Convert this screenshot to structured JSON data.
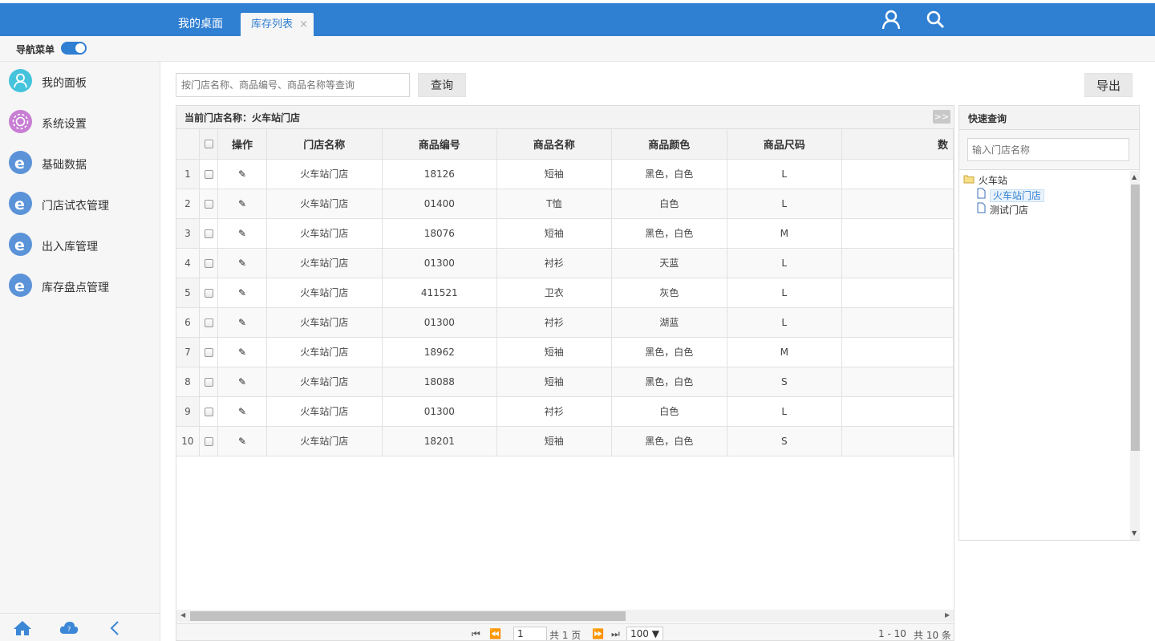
{
  "topbar": {
    "tabs": [
      {
        "label": "我的桌面"
      },
      {
        "label": "库存列表",
        "close": "×"
      }
    ],
    "icons": [
      "user-icon",
      "search-icon"
    ]
  },
  "nav": {
    "toggle_label": "导航菜单",
    "toggle_on": true
  },
  "sidebar": {
    "items": [
      {
        "label": "我的面板",
        "icon": "user-icon"
      },
      {
        "label": "系统设置",
        "icon": "gear-icon"
      },
      {
        "label": "基础数据",
        "icon": "ie-icon"
      },
      {
        "label": "门店试衣管理",
        "icon": "ie-icon"
      },
      {
        "label": "出入库管理",
        "icon": "ie-icon"
      },
      {
        "label": "库存盘点管理",
        "icon": "ie-icon"
      }
    ],
    "bottom_icons": [
      "home-icon",
      "cloud-help-icon",
      "collapse-left-icon"
    ]
  },
  "toolbar": {
    "search_placeholder": "按门店名称、商品编号、商品名称等查询",
    "query_label": "查询",
    "export_label": "导出"
  },
  "grid": {
    "caption": "当前门店名称：火车站门店",
    "expand_label": ">>",
    "columns": [
      "操作",
      "门店名称",
      "商品编号",
      "商品名称",
      "商品颜色",
      "商品尺码",
      "数"
    ],
    "rows": [
      {
        "n": "1",
        "store": "火车站门店",
        "code": "18126",
        "name": "短袖",
        "color": "黑色，白色",
        "size": "L"
      },
      {
        "n": "2",
        "store": "火车站门店",
        "code": "01400",
        "name": "T恤",
        "color": "白色",
        "size": "L"
      },
      {
        "n": "3",
        "store": "火车站门店",
        "code": "18076",
        "name": "短袖",
        "color": "黑色，白色",
        "size": "M"
      },
      {
        "n": "4",
        "store": "火车站门店",
        "code": "01300",
        "name": "衬衫",
        "color": "天蓝",
        "size": "L"
      },
      {
        "n": "5",
        "store": "火车站门店",
        "code": "411521",
        "name": "卫衣",
        "color": "灰色",
        "size": "L"
      },
      {
        "n": "6",
        "store": "火车站门店",
        "code": "01300",
        "name": "衬衫",
        "color": "湖蓝",
        "size": "L"
      },
      {
        "n": "7",
        "store": "火车站门店",
        "code": "18962",
        "name": "短袖",
        "color": "黑色，白色",
        "size": "M"
      },
      {
        "n": "8",
        "store": "火车站门店",
        "code": "18088",
        "name": "短袖",
        "color": "黑色，白色",
        "size": "S"
      },
      {
        "n": "9",
        "store": "火车站门店",
        "code": "01300",
        "name": "衬衫",
        "color": "白色",
        "size": "L"
      },
      {
        "n": "10",
        "store": "火车站门店",
        "code": "18201",
        "name": "短袖",
        "color": "黑色，白色",
        "size": "S"
      }
    ]
  },
  "pager": {
    "page": "1",
    "total_pages": "共 1 页",
    "page_size": "100 ▼",
    "range": "1 - 10",
    "total": "共 10 条"
  },
  "quick": {
    "title": "快速查询",
    "input_placeholder": "输入门店名称",
    "tree": {
      "root": "火车站",
      "children": [
        "火车站门店",
        "测试门店"
      ],
      "selected": "火车站门店"
    }
  },
  "colors": {
    "accent": "#2f7fd2",
    "panel_bg": "#f6f6f6"
  }
}
